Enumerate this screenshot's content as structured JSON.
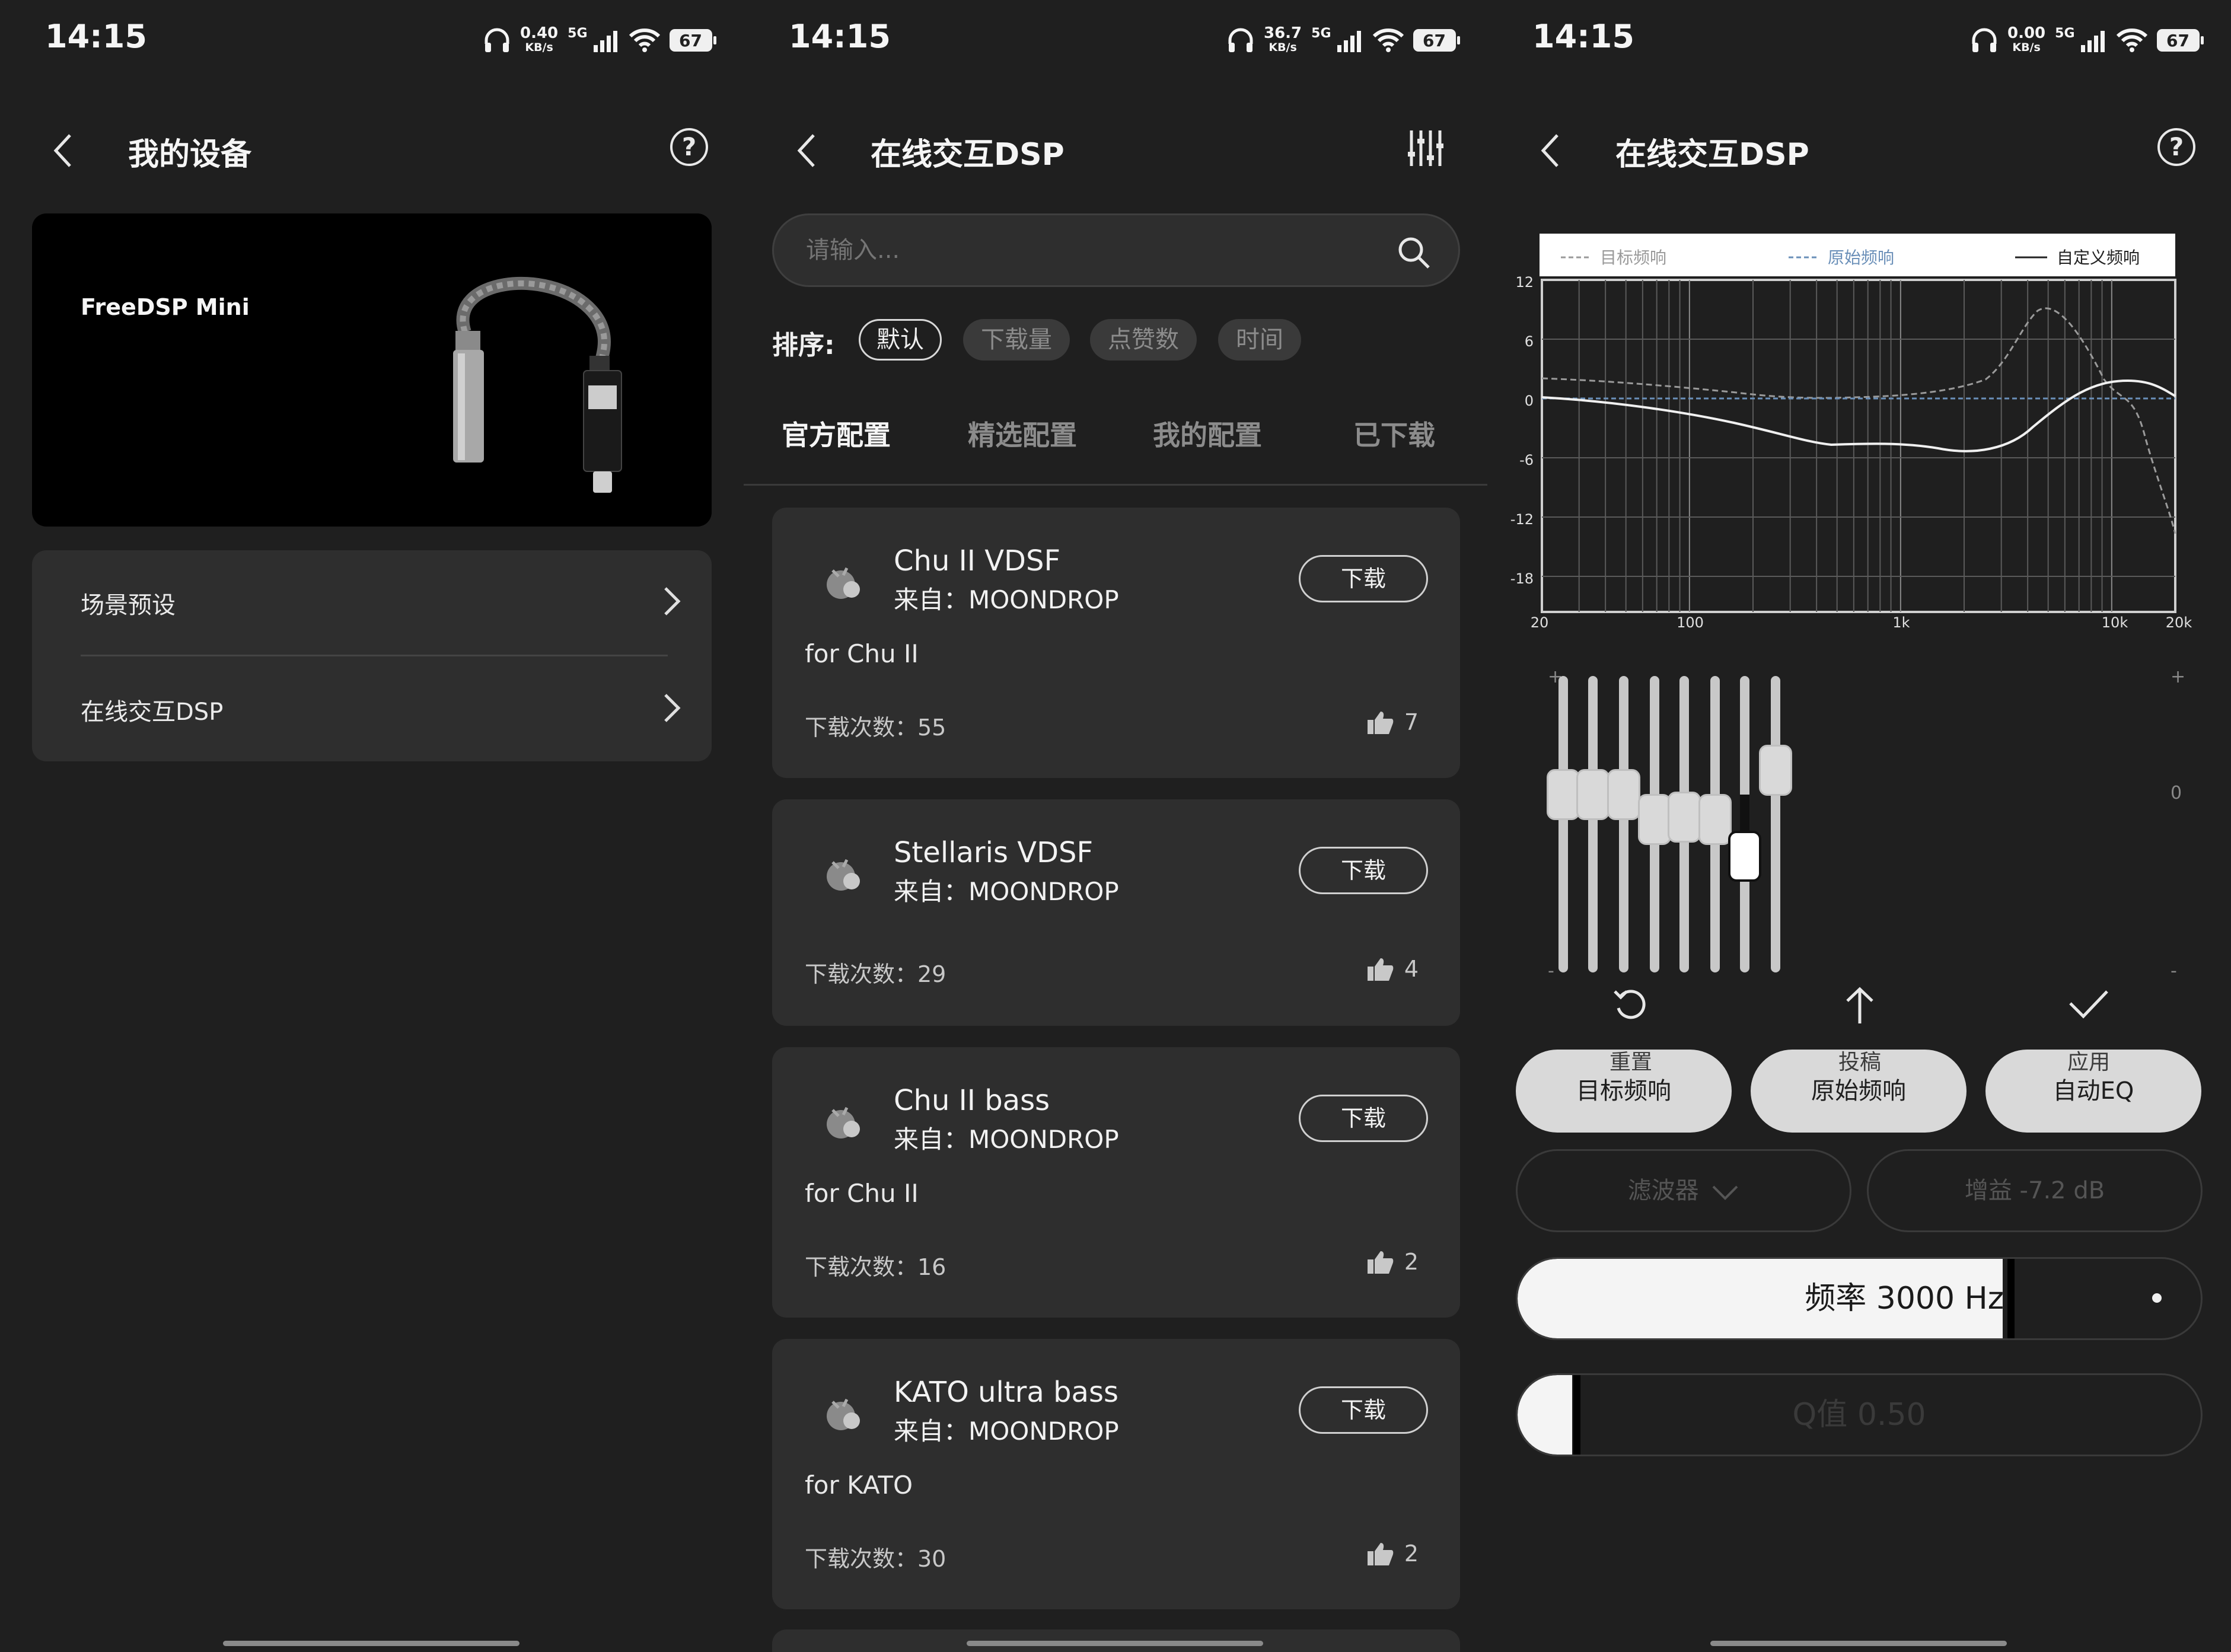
{
  "status": {
    "time": "14:15",
    "net1": {
      "value": "0.40",
      "unit": "KB/s"
    },
    "net2": {
      "value": "36.7",
      "unit": "KB/s"
    },
    "net3": {
      "value": "0.00",
      "unit": "KB/s"
    },
    "signal": "5G",
    "battery": "67"
  },
  "panel1": {
    "title": "我的设备",
    "device_name": "FreeDSP Mini",
    "menu": [
      {
        "label": "场景预设"
      },
      {
        "label": "在线交互DSP"
      }
    ]
  },
  "panel2": {
    "title": "在线交互DSP",
    "search_placeholder": "请输入...",
    "sort_label": "排序:",
    "sort_options": [
      "默认",
      "下载量",
      "点赞数",
      "时间"
    ],
    "tabs": [
      "官方配置",
      "精选配置",
      "我的配置",
      "已下载"
    ],
    "download_label": "下载",
    "profiles": [
      {
        "name": "Chu II VDSF",
        "from": "来自：MOONDROP",
        "desc": "for Chu II",
        "downloads": "下载次数：55",
        "likes": "7"
      },
      {
        "name": "Stellaris VDSF",
        "from": "来自：MOONDROP",
        "desc": "",
        "downloads": "下载次数：29",
        "likes": "4"
      },
      {
        "name": "Chu II bass",
        "from": "来自：MOONDROP",
        "desc": "for Chu II",
        "downloads": "下载次数：16",
        "likes": "2"
      },
      {
        "name": "KATO ultra bass",
        "from": "来自：MOONDROP",
        "desc": "for KATO",
        "downloads": "下载次数：30",
        "likes": "2"
      }
    ]
  },
  "panel3": {
    "title": "在线交互DSP",
    "legend": {
      "target": "目标频响",
      "original": "原始频响",
      "custom": "自定义频响"
    },
    "y_ticks": [
      "12",
      "6",
      "0",
      "-6",
      "-12",
      "-18"
    ],
    "x_ticks": [
      "20",
      "100",
      "1k",
      "10k",
      "20k"
    ],
    "slider_marks": {
      "plus": "+",
      "zero": "0",
      "minus": "-"
    },
    "slider_levels": [
      0.62,
      0.62,
      0.62,
      0.52,
      0.53,
      0.52,
      0.37,
      0.72
    ],
    "selected_slider": 7,
    "buttons": {
      "target": "目标频响",
      "original": "原始频响",
      "auto_eq": "自动EQ"
    },
    "filter_label": "滤波器",
    "gain_label": "增益 -7.2 dB",
    "freq_label": "频率 3000 Hz",
    "freq_fraction": 0.71,
    "q_label": "Q值 0.50",
    "q_fraction": 0.08,
    "actions": {
      "reset": "重置",
      "submit": "投稿",
      "apply": "应用"
    }
  },
  "colors": {
    "bg": "#1f1f1f",
    "card": "#2e2e2e",
    "chart_bg": "#ffffff"
  }
}
